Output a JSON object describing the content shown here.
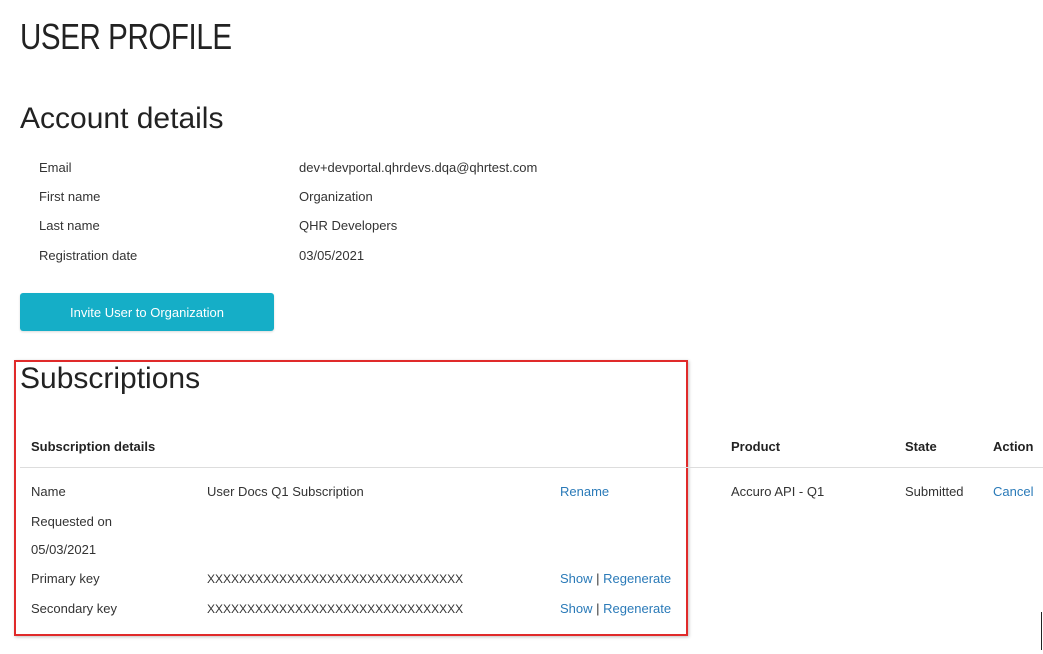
{
  "page": {
    "title": "USER PROFILE"
  },
  "account": {
    "title": "Account details",
    "rows": [
      {
        "label": "Email",
        "value": "dev+devportal.qhrdevs.dqa@qhrtest.com"
      },
      {
        "label": "First name",
        "value": "Organization"
      },
      {
        "label": "Last name",
        "value": "QHR Developers"
      },
      {
        "label": "Registration date",
        "value": "03/05/2021"
      }
    ],
    "invite_label": "Invite User to Organization"
  },
  "subscriptions": {
    "title": "Subscriptions",
    "headers": {
      "details": "Subscription details",
      "product": "Product",
      "state": "State",
      "action": "Action"
    },
    "name_label": "Name",
    "name_value": "User Docs Q1 Subscription",
    "rename_label": "Rename",
    "product_value": "Accuro API - Q1",
    "state_value": "Submitted",
    "cancel_label": "Cancel",
    "requested_label": "Requested on",
    "requested_value": "05/03/2021",
    "primary_label": "Primary key",
    "primary_value": "XXXXXXXXXXXXXXXXXXXXXXXXXXXXXXXX",
    "secondary_label": "Secondary key",
    "secondary_value": "XXXXXXXXXXXXXXXXXXXXXXXXXXXXXXXX",
    "show_label": "Show",
    "separator": "|",
    "regenerate_label": "Regenerate"
  },
  "colors": {
    "accent": "#15aec7",
    "link": "#2a7ab8",
    "highlight": "#e02a2a"
  }
}
